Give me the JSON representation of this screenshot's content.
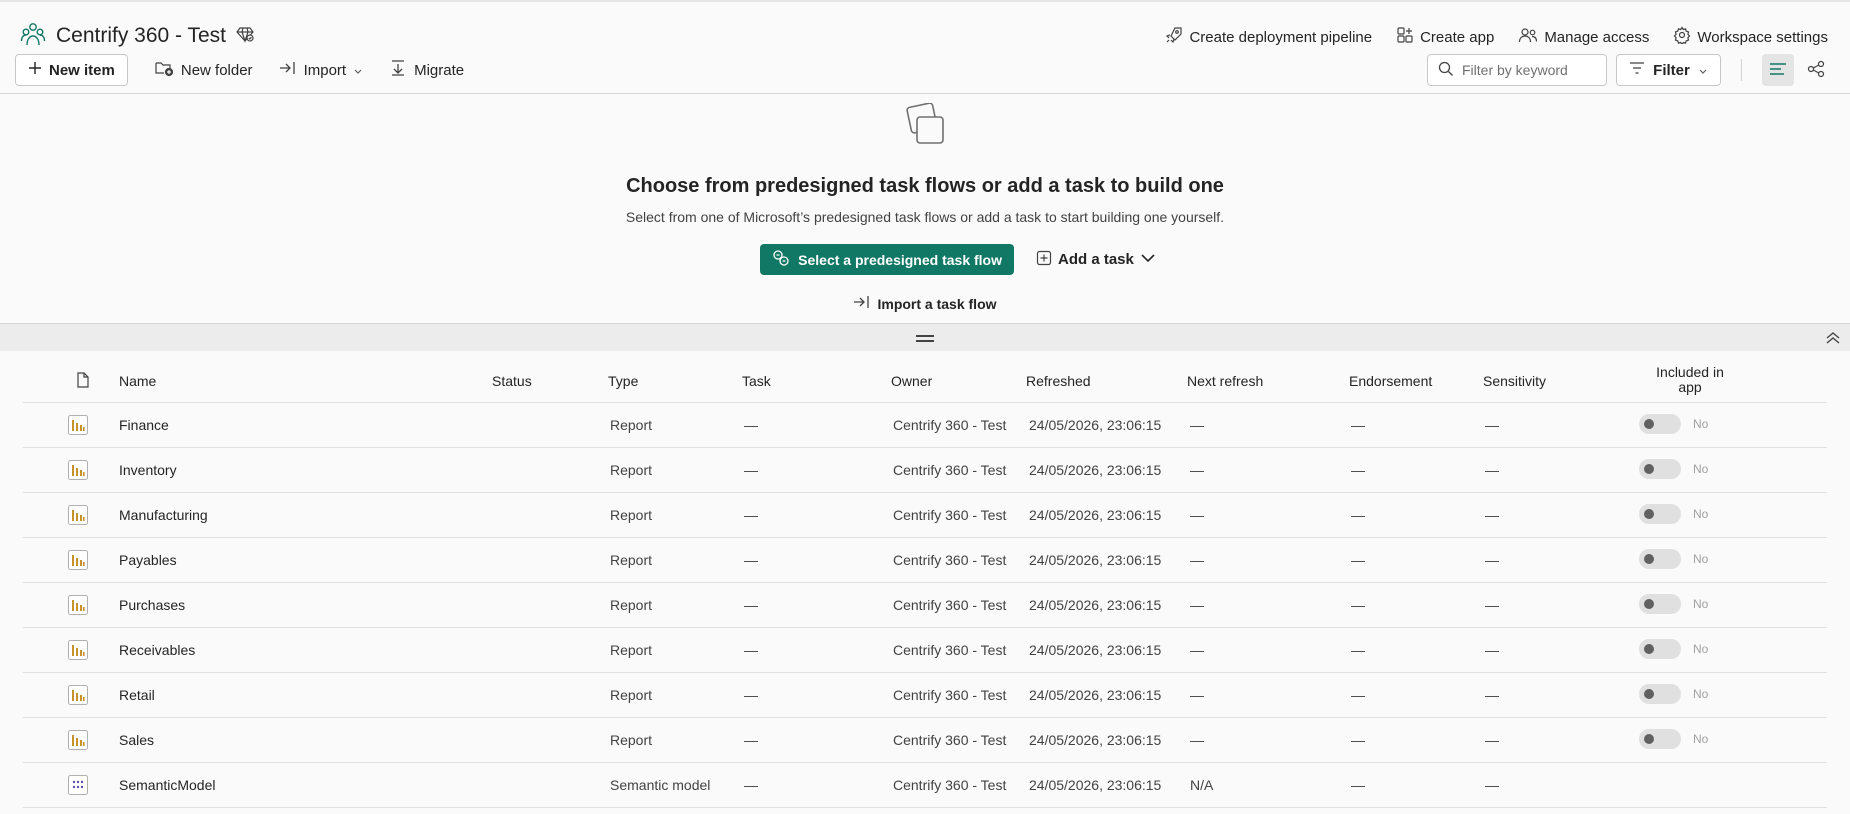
{
  "workspace": {
    "name": "Centrify 360 - Test"
  },
  "header_actions": [
    {
      "label": "Create deployment pipeline",
      "icon": "rocket-icon"
    },
    {
      "label": "Create app",
      "icon": "app-icon"
    },
    {
      "label": "Manage access",
      "icon": "people-icon"
    },
    {
      "label": "Workspace settings",
      "icon": "gear-icon"
    }
  ],
  "toolbar": {
    "new_item": "New item",
    "new_folder": "New folder",
    "import": "Import",
    "migrate": "Migrate"
  },
  "search": {
    "placeholder": "Filter by keyword",
    "value": ""
  },
  "filter": {
    "label": "Filter"
  },
  "taskflow": {
    "title": "Choose from predesigned task flows or add a task to build one",
    "subtitle": "Select from one of Microsoft’s predesigned task flows or add a task to start building one yourself.",
    "primary_button": "Select a predesigned task flow",
    "add_task": "Add a task",
    "import_task_flow": "Import a task flow"
  },
  "table": {
    "headers": {
      "name": "Name",
      "status": "Status",
      "type": "Type",
      "task": "Task",
      "owner": "Owner",
      "refreshed": "Refreshed",
      "next_refresh": "Next refresh",
      "endorsement": "Endorsement",
      "sensitivity": "Sensitivity",
      "included_line1": "Included in",
      "included_line2": "app"
    },
    "rows": [
      {
        "name": "Finance",
        "type": "Report",
        "task": "—",
        "owner": "Centrify 360 - Test",
        "refreshed": "24/05/2026, 23:06:15",
        "next_refresh": "—",
        "endorsement": "—",
        "sensitivity": "—",
        "included": "No",
        "kind": "report"
      },
      {
        "name": "Inventory",
        "type": "Report",
        "task": "—",
        "owner": "Centrify 360 - Test",
        "refreshed": "24/05/2026, 23:06:15",
        "next_refresh": "—",
        "endorsement": "—",
        "sensitivity": "—",
        "included": "No",
        "kind": "report"
      },
      {
        "name": "Manufacturing",
        "type": "Report",
        "task": "—",
        "owner": "Centrify 360 - Test",
        "refreshed": "24/05/2026, 23:06:15",
        "next_refresh": "—",
        "endorsement": "—",
        "sensitivity": "—",
        "included": "No",
        "kind": "report"
      },
      {
        "name": "Payables",
        "type": "Report",
        "task": "—",
        "owner": "Centrify 360 - Test",
        "refreshed": "24/05/2026, 23:06:15",
        "next_refresh": "—",
        "endorsement": "—",
        "sensitivity": "—",
        "included": "No",
        "kind": "report"
      },
      {
        "name": "Purchases",
        "type": "Report",
        "task": "—",
        "owner": "Centrify 360 - Test",
        "refreshed": "24/05/2026, 23:06:15",
        "next_refresh": "—",
        "endorsement": "—",
        "sensitivity": "—",
        "included": "No",
        "kind": "report"
      },
      {
        "name": "Receivables",
        "type": "Report",
        "task": "—",
        "owner": "Centrify 360 - Test",
        "refreshed": "24/05/2026, 23:06:15",
        "next_refresh": "—",
        "endorsement": "—",
        "sensitivity": "—",
        "included": "No",
        "kind": "report"
      },
      {
        "name": "Retail",
        "type": "Report",
        "task": "—",
        "owner": "Centrify 360 - Test",
        "refreshed": "24/05/2026, 23:06:15",
        "next_refresh": "—",
        "endorsement": "—",
        "sensitivity": "—",
        "included": "No",
        "kind": "report"
      },
      {
        "name": "Sales",
        "type": "Report",
        "task": "—",
        "owner": "Centrify 360 - Test",
        "refreshed": "24/05/2026, 23:06:15",
        "next_refresh": "—",
        "endorsement": "—",
        "sensitivity": "—",
        "included": "No",
        "kind": "report"
      },
      {
        "name": "SemanticModel",
        "type": "Semantic model",
        "task": "—",
        "owner": "Centrify 360 - Test",
        "refreshed": "24/05/2026, 23:06:15",
        "next_refresh": "N/A",
        "endorsement": "—",
        "sensitivity": "—",
        "included": "",
        "kind": "semantic"
      }
    ]
  },
  "colors": {
    "accent": "#117865",
    "report_icon": "#c8922a",
    "semantic_icon": "#5b4fa8"
  }
}
